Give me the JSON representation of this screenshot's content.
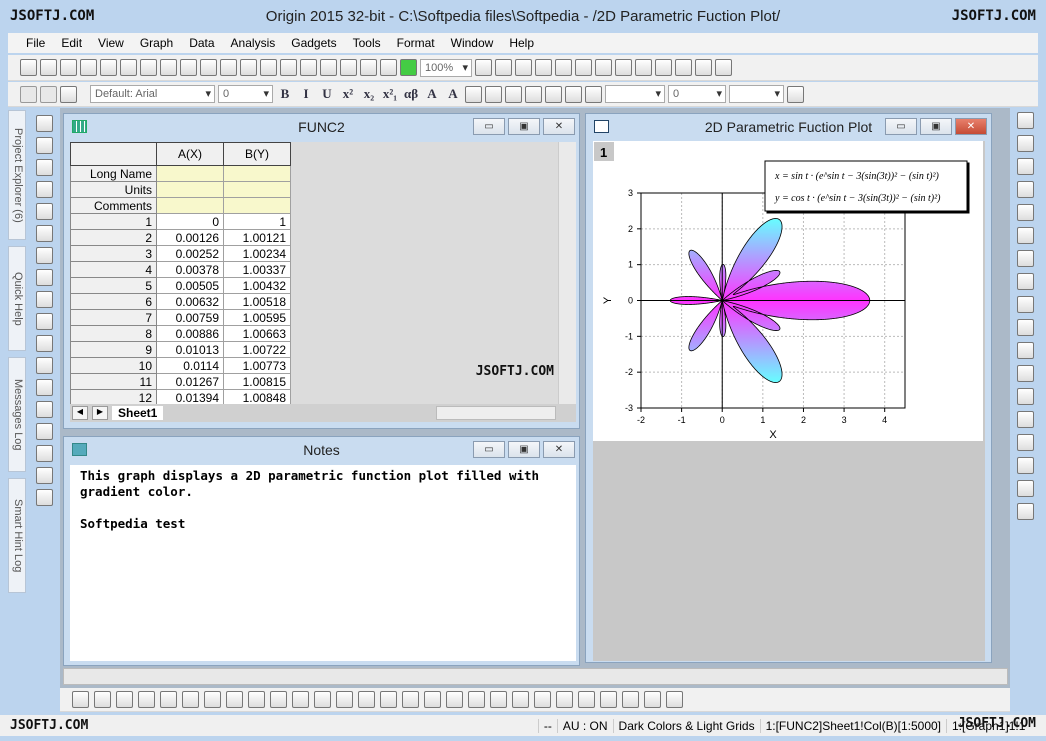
{
  "titlebar": {
    "watermark": "JSOFTJ.COM",
    "title": "Origin 2015 32-bit - C:\\Softpedia files\\Softpedia - /2D Parametric Fuction Plot/",
    "watermark_right": "JSOFTJ.COM"
  },
  "menu": [
    "File",
    "Edit",
    "View",
    "Graph",
    "Data",
    "Analysis",
    "Gadgets",
    "Tools",
    "Format",
    "Window",
    "Help"
  ],
  "toolbar": {
    "zoom": "100%",
    "font": "Default: Arial",
    "font_size": "0",
    "format_buttons": [
      "B",
      "I",
      "U",
      "x²",
      "x₂",
      "x²₁",
      "αβ",
      "A",
      "A"
    ],
    "line_width": "0"
  },
  "side_tabs": [
    "Project Explorer (6)",
    "Quick Help",
    "Messages Log",
    "Smart Hint Log"
  ],
  "worksheet": {
    "title": "FUNC2",
    "columns": [
      "A(X)",
      "B(Y)"
    ],
    "meta_rows": [
      "Long Name",
      "Units",
      "Comments"
    ],
    "rows": [
      [
        "1",
        "0",
        "1"
      ],
      [
        "2",
        "0.00126",
        "1.00121"
      ],
      [
        "3",
        "0.00252",
        "1.00234"
      ],
      [
        "4",
        "0.00378",
        "1.00337"
      ],
      [
        "5",
        "0.00505",
        "1.00432"
      ],
      [
        "6",
        "0.00632",
        "1.00518"
      ],
      [
        "7",
        "0.00759",
        "1.00595"
      ],
      [
        "8",
        "0.00886",
        "1.00663"
      ],
      [
        "9",
        "0.01013",
        "1.00722"
      ],
      [
        "10",
        "0.0114",
        "1.00773"
      ],
      [
        "11",
        "0.01267",
        "1.00815"
      ],
      [
        "12",
        "0.01394",
        "1.00848"
      ]
    ],
    "sheet_tab": "Sheet1",
    "watermark": "JSOFTJ.COM"
  },
  "notes": {
    "title": "Notes",
    "text": "This graph displays a 2D parametric function plot filled with\ngradient color.\n\nSoftpedia test"
  },
  "graph": {
    "title": "2D Parametric Fuction Plot",
    "layer": "1",
    "eq_x": "x = sin t · (e^sin t − 3(sin(3t))² − (sin t)²)",
    "eq_y": "y = cos t · (e^sin t − 3(sin(3t))² − (sin t)²)"
  },
  "chart_data": {
    "type": "line",
    "fill": "gradient",
    "fill_colors": [
      "#ff33ff",
      "#66ffff"
    ],
    "x_formula": "sin(t)*(exp(sin(t))-3*sin(3t)^2-sin(t)^2)",
    "y_formula": "cos(t)*(exp(sin(t))-3*sin(3t)^2-sin(t)^2)",
    "xlabel": "X",
    "ylabel": "Y",
    "xlim": [
      -2,
      4.5
    ],
    "ylim": [
      -3,
      3
    ],
    "xticks": [
      "-2",
      "-1",
      "0",
      "1",
      "2",
      "3",
      "4"
    ],
    "yticks": [
      "3",
      "2",
      "1",
      "0",
      "-1",
      "-2",
      "-3"
    ],
    "grid": true
  },
  "status": {
    "left": "JSOFTJ.COM",
    "items": [
      "--",
      "AU : ON",
      "Dark Colors & Light Grids",
      "1:[FUNC2]Sheet1!Col(B)[1:5000]",
      "1:[Graph1]1!1"
    ],
    "watermark_right": "JSOFTJ.COM"
  }
}
